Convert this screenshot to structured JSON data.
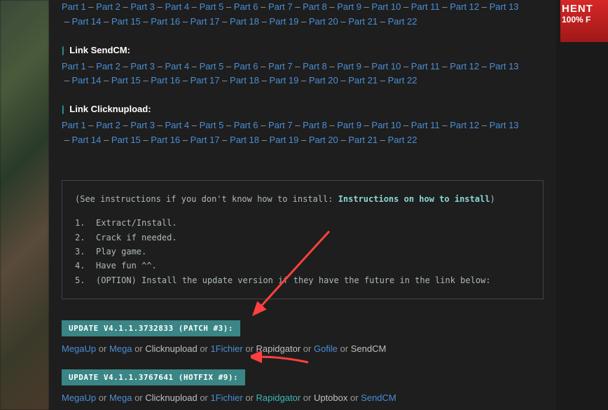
{
  "ad": {
    "line1": "HENT",
    "line2": "100% F"
  },
  "partLabel": "Part",
  "partCount": 22,
  "firstParts": 22,
  "headers": {
    "sendcm": "Link SendCM:",
    "clicknupload": "Link Clicknupload:"
  },
  "instructions": {
    "introPrefix": "(See instructions if you don't know how to install: ",
    "introLink": "Instructions on how to install",
    "introSuffix": ")",
    "steps": [
      "Extract/Install.",
      "Crack if needed.",
      "Play game.",
      "Have fun ^^.",
      "(OPTION) Install the update version if they have the future in the link below:"
    ]
  },
  "updates": [
    {
      "badge": "UPDATE V4.1.1.3732833 (PATCH #3):",
      "mirrors": [
        {
          "name": "MegaUp",
          "link": true,
          "teal": false
        },
        {
          "name": "Mega",
          "link": true,
          "teal": false
        },
        {
          "name": "Clicknupload",
          "link": false
        },
        {
          "name": "1Fichier",
          "link": true,
          "teal": false
        },
        {
          "name": "Rapidgator",
          "link": false
        },
        {
          "name": "Gofile",
          "link": true,
          "teal": false
        },
        {
          "name": "SendCM",
          "link": false
        }
      ]
    },
    {
      "badge": "UPDATE V4.1.1.3767641 (HOTFIX #9):",
      "mirrors": [
        {
          "name": "MegaUp",
          "link": true,
          "teal": false
        },
        {
          "name": "Mega",
          "link": true,
          "teal": false
        },
        {
          "name": "Clicknupload",
          "link": false
        },
        {
          "name": "1Fichier",
          "link": true,
          "teal": false
        },
        {
          "name": "Rapidgator",
          "link": true,
          "teal": true
        },
        {
          "name": "Uptobox",
          "link": false
        },
        {
          "name": "SendCM",
          "link": true,
          "teal": false
        }
      ]
    }
  ],
  "joinSep": " – ",
  "or": " or "
}
